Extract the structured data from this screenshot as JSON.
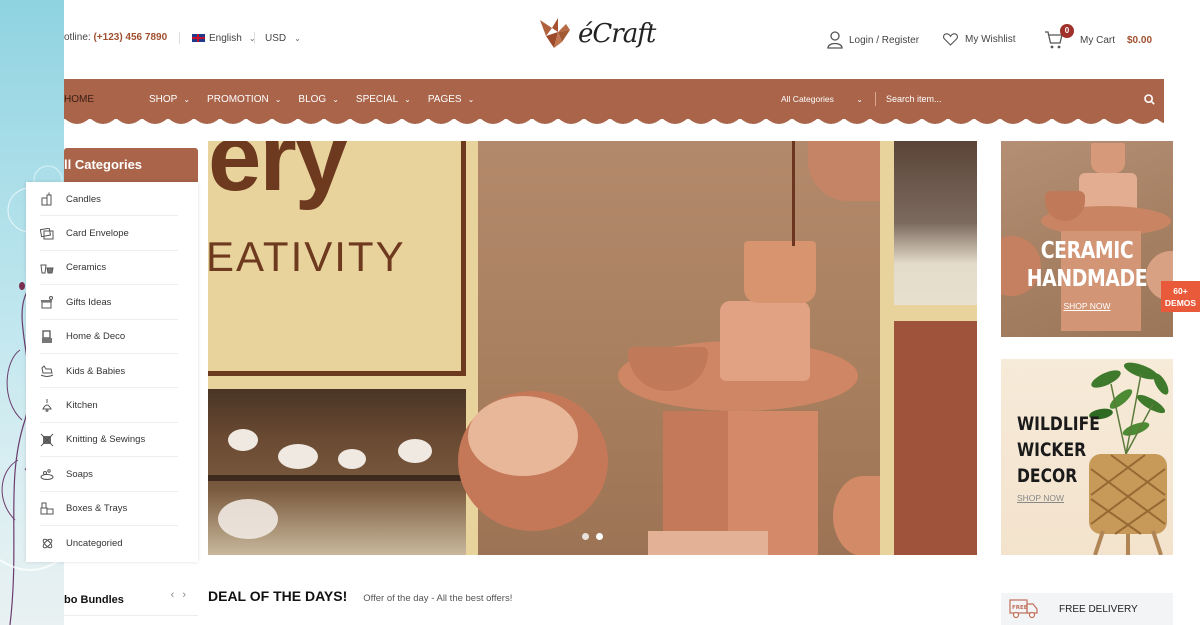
{
  "topbar": {
    "hotline_label": "otline:",
    "hotline_number": "(+123) 456 7890",
    "language": "English",
    "currency": "USD"
  },
  "logo": {
    "text": "Craft",
    "prefix": "é"
  },
  "account": {
    "login_label": "Login / Register",
    "wishlist_label": "My Wishlist",
    "cart_label": "My Cart",
    "cart_count": "0",
    "cart_total": "$0.00"
  },
  "nav": {
    "items": [
      {
        "label": "HOME",
        "active": true,
        "dropdown": false
      },
      {
        "label": "SHOP",
        "active": false,
        "dropdown": true
      },
      {
        "label": "PROMOTION",
        "active": false,
        "dropdown": true
      },
      {
        "label": "BLOG",
        "active": false,
        "dropdown": true
      },
      {
        "label": "SPECIAL",
        "active": false,
        "dropdown": true
      },
      {
        "label": "PAGES",
        "active": false,
        "dropdown": true
      }
    ],
    "category_select": "All Categories",
    "search_placeholder": "Search item..."
  },
  "categories": {
    "title": "ll Categories",
    "items": [
      {
        "label": "Candles",
        "icon": "candle-icon"
      },
      {
        "label": "Card Envelope",
        "icon": "card-envelope-icon"
      },
      {
        "label": "Ceramics",
        "icon": "ceramics-icon"
      },
      {
        "label": "Gifts Ideas",
        "icon": "gift-icon"
      },
      {
        "label": "Home & Deco",
        "icon": "home-deco-icon"
      },
      {
        "label": "Kids & Babies",
        "icon": "rocking-horse-icon"
      },
      {
        "label": "Kitchen",
        "icon": "kitchen-lamp-icon"
      },
      {
        "label": "Knitting & Sewings",
        "icon": "knitting-icon"
      },
      {
        "label": "Soaps",
        "icon": "soap-icon"
      },
      {
        "label": "Boxes & Trays",
        "icon": "boxes-icon"
      },
      {
        "label": "Uncategoried",
        "icon": "uncategorized-icon"
      }
    ]
  },
  "combo": {
    "title": "bo Bundles",
    "prev": "‹",
    "next": "›"
  },
  "hero": {
    "big_text": "ery",
    "sub_text": "EATIVITY",
    "slides": 2,
    "active_slide": 2
  },
  "banners": [
    {
      "title_line1": "CERAMIC",
      "title_line2": "HANDMADE",
      "cta": "SHOP NOW"
    },
    {
      "title_line1": "WILDLIFE",
      "title_line2": "WICKER",
      "title_line3": "DECOR",
      "cta": "SHOP NOW"
    }
  ],
  "demos_badge": {
    "line1": "60+",
    "line2": "DEMOS"
  },
  "deal": {
    "title": "DEAL OF THE DAYS!",
    "subtitle": "Offer of the day - All the best offers!"
  },
  "features": [
    {
      "label": "FREE DELIVERY",
      "icon": "free-delivery-truck-icon"
    }
  ],
  "colors": {
    "brand": "#a9644a",
    "accent_text": "#a0502f",
    "badge": "#a0302a",
    "demos": "#e85a3a"
  }
}
